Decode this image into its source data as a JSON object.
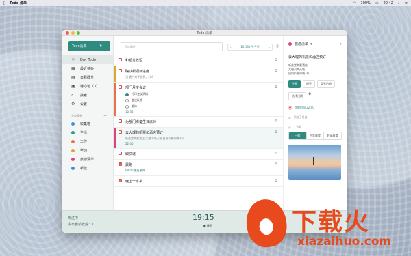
{
  "menubar": {
    "app": "Todo 清单",
    "battery": "100%",
    "time": "20:42"
  },
  "window": {
    "title": "Todo 清单"
  },
  "sidebar": {
    "brand": "Todo清单",
    "items": [
      {
        "label": "Day Todo",
        "icon": "sun-icon"
      },
      {
        "label": "最近待办",
        "icon": "calendar-icon"
      },
      {
        "label": "日程概览",
        "icon": "grid-icon"
      },
      {
        "label": "待办箱（3）",
        "icon": "inbox-icon"
      },
      {
        "label": "搜索",
        "icon": "search-icon"
      },
      {
        "label": "设置",
        "icon": "gear-icon"
      }
    ],
    "section_label": "分类清单",
    "lists": [
      {
        "label": "收集箱",
        "color": "#3a8fd8"
      },
      {
        "label": "生活",
        "color": "#2f9a8a"
      },
      {
        "label": "工作",
        "color": "#e8734a"
      },
      {
        "label": "学习",
        "color": "#e0a531"
      },
      {
        "label": "旅游清单",
        "color": "#d9457a"
      },
      {
        "label": "新建",
        "color": "#3a8fd8"
      }
    ]
  },
  "status": {
    "label": "专注中",
    "count": "今日番茄收成：1",
    "time": "19:15",
    "mode": "◀) 春雨"
  },
  "main": {
    "search_placeholder": "添加事件",
    "date": "10月30日 今天",
    "rows": [
      {
        "title": "和起总收短",
        "color": "#d35050"
      },
      {
        "title": "确认新项目进度",
        "sub": "当 客户对于收费，对吗",
        "color": "#d35050",
        "bar": "#e0a531"
      },
      {
        "title": "部门月度会议",
        "color": "#d35050",
        "bar": "#e8734a",
        "meta": "10:35",
        "subitems": [
          {
            "label": "打印会议资料",
            "done": true
          },
          {
            "label": "会议反馈",
            "done": false
          },
          {
            "label": "解体",
            "done": false
          }
        ]
      },
      {
        "title": "为部门准备生日派对",
        "color": "#d35050"
      },
      {
        "title": "去大理的机票和酒店预订",
        "sub": "听花堂海景酒店 大理洱海天境 目前价格四晚3号",
        "color": "#d35050",
        "meta": "22:00",
        "bar": "#d9457a",
        "selected": true
      },
      {
        "title": "取快递",
        "color": "#d35050"
      },
      {
        "title": "晨跑",
        "color": "#d35050",
        "checked": true,
        "meta": "08:00  重复事件"
      },
      {
        "title": "晚上一本书",
        "color": "#d35050",
        "checked": true
      }
    ]
  },
  "detail": {
    "list_name": "旅游清单",
    "title": "去大理的机票和酒店预订",
    "notes": "听花堂海景酒店\n大理洱海天境\n目前价格四晚3号",
    "tags": [
      "今天",
      "明天",
      "暂无日期"
    ],
    "date_btn": "选择日期",
    "reminder": "提醒时间 22:00",
    "add_sub": "添加子任务",
    "section": "工作组",
    "segments": [
      "一般",
      "中等难度",
      "较高难度"
    ]
  },
  "watermark": {
    "big": "下载火",
    "small": "xiazaihuo.com"
  }
}
